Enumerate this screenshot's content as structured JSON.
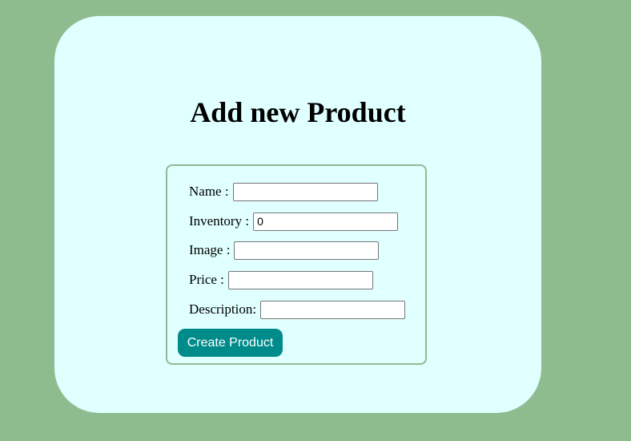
{
  "page": {
    "title": "Add new Product"
  },
  "form": {
    "fields": [
      {
        "label": "Name :",
        "value": "",
        "placeholder": ""
      },
      {
        "label": "Inventory :",
        "value": "0",
        "placeholder": ""
      },
      {
        "label": "Image :",
        "value": "",
        "placeholder": ""
      },
      {
        "label": "Price :",
        "value": "",
        "placeholder": ""
      },
      {
        "label": "Description:",
        "value": "",
        "placeholder": ""
      }
    ],
    "submit_label": "Create Product"
  },
  "colors": {
    "background": "#8fbc8f",
    "card": "#e0ffff",
    "form_border": "#8fbc8f",
    "button": "#008b8b",
    "button_text": "#ffffff"
  }
}
